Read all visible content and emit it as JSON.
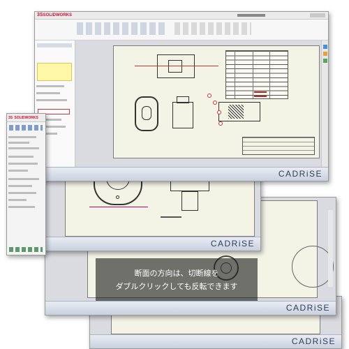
{
  "app": {
    "logo_text": "SOLIDWORKS",
    "logo_mark": "3S"
  },
  "brand": {
    "watermark": "CADRiSE",
    "watermark_color": "#2f3d5c"
  },
  "caption": {
    "line1": "断面の方向は、切断線を",
    "line2": "ダブルクリックしても反転できます"
  },
  "colors": {
    "sheet_background": "#f3f3e6",
    "highlight_red": "#d2333d",
    "feature_tree_yellow": "#fff7a8",
    "caption_background": "rgba(30,30,30,0.62)"
  },
  "icons": [
    "solidworks-logo-icon",
    "task-pane-icon",
    "section-view-icon",
    "drawing-view-icon"
  ]
}
